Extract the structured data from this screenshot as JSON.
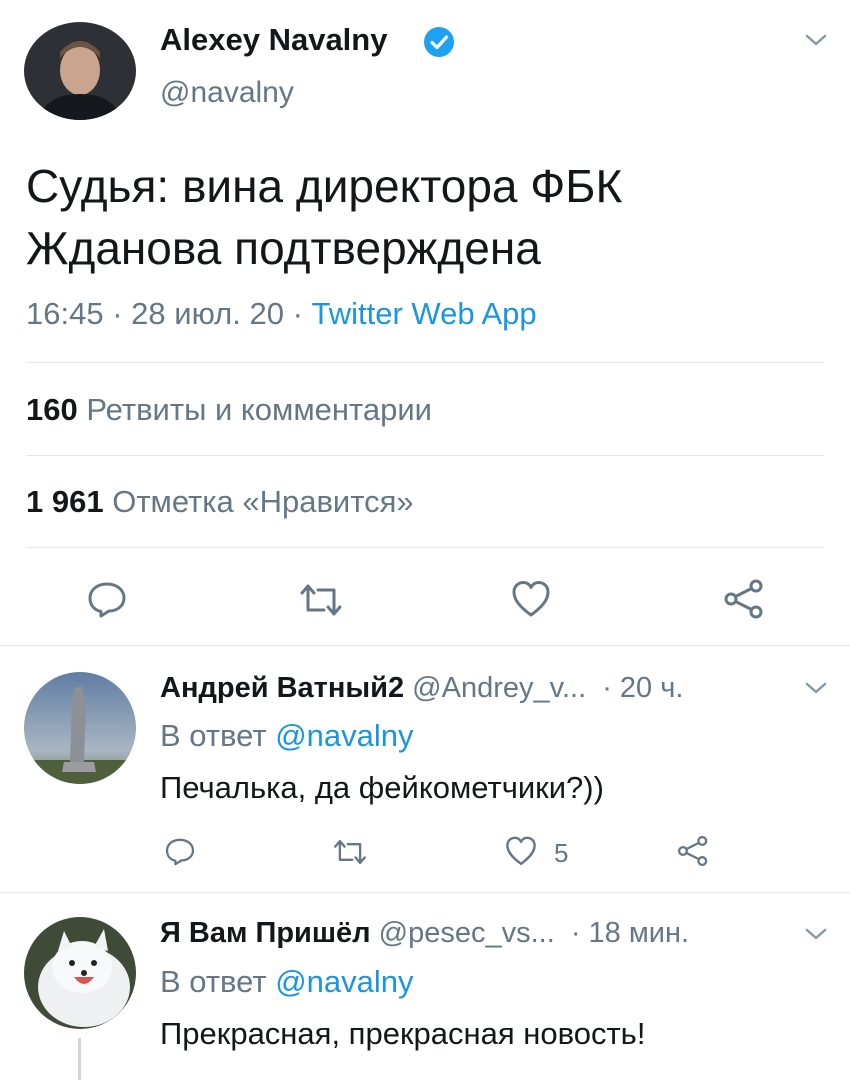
{
  "main_tweet": {
    "author_name": "Alexey Navalny",
    "author_handle": "@navalny",
    "text_line1": "Судья: вина директора ФБК",
    "text_line2": "Жданова подтверждена",
    "time": "16:45",
    "date": "28 июл. 20",
    "separator": "·",
    "source": "Twitter Web App",
    "retweets_count": "160",
    "retweets_label": "Ретвиты и комментарии",
    "likes_count": "1 961",
    "likes_label": "Отметка «Нравится»"
  },
  "replies": [
    {
      "author_name": "Андрей Ватный2",
      "author_handle": "@Andrey_v...",
      "time": "· 20 ч.",
      "reply_prefix": "В ответ",
      "reply_to": "@navalny",
      "text": "Печалька, да фейкометчики?))",
      "like_count": "5"
    },
    {
      "author_name": "Я Вам Пришёл",
      "author_handle": "@pesec_vs...",
      "time": "· 18 мин.",
      "reply_prefix": "В ответ",
      "reply_to": "@navalny",
      "text": "Прекрасная, прекрасная новость!"
    }
  ],
  "colors": {
    "accent": "#1b95e0",
    "text": "#14171a",
    "secondary": "#657786",
    "divider": "#e1e8ed"
  },
  "icons": [
    "chevron-down-icon",
    "verified-badge-icon",
    "reply-icon",
    "retweet-icon",
    "like-icon",
    "share-icon"
  ]
}
